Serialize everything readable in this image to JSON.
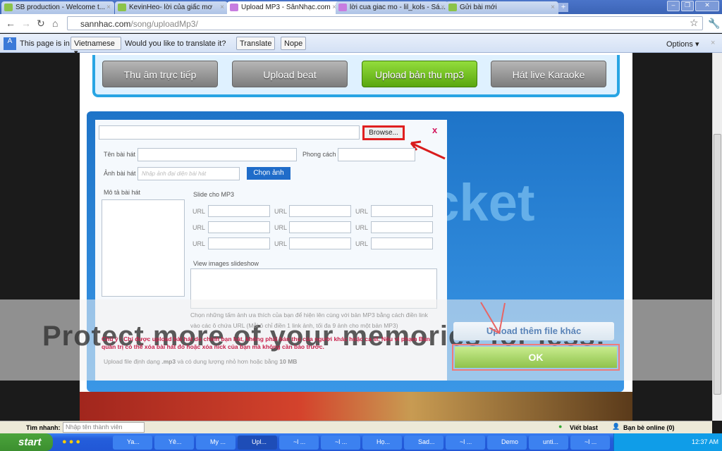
{
  "browser": {
    "tabs": [
      {
        "label": "SB production - Welcome t...",
        "active": false
      },
      {
        "label": "KevinHeo- lời của giấc mơ",
        "active": false
      },
      {
        "label": "Upload MP3 - SânNhạc.com",
        "active": true
      },
      {
        "label": "lời cua giac mo - lil_kols - Sá...",
        "active": false
      },
      {
        "label": "Gửi bài mới",
        "active": false
      }
    ],
    "url_host": "sannhac.com",
    "url_path": "/song/uploadMp3/",
    "translate": {
      "prefix": "This page is in",
      "language": "Vietnamese",
      "question": "Would you like to translate it?",
      "translate_btn": "Translate",
      "nope_btn": "Nope",
      "options": "Options"
    }
  },
  "header_buttons": [
    {
      "label": "Thu âm trực tiếp",
      "active": false
    },
    {
      "label": "Upload beat",
      "active": false
    },
    {
      "label": "Upload bản thu mp3",
      "active": true
    },
    {
      "label": "Hát live Karaoke",
      "active": false
    }
  ],
  "form": {
    "browse": "Browse...",
    "close": "x",
    "song_name_label": "Tên bài hát",
    "style_label": "Phong cách",
    "image_label": "Ảnh bài hát",
    "image_placeholder": "Nhập ảnh đại diện bài hát",
    "choose_image": "Chọn ảnh",
    "desc_label": "Mô tả bài hát",
    "slide_label": "Slide cho MP3",
    "url_label": "URL",
    "slideshow_label": "View images slideshow",
    "slide_note": "Chọn những tấm ảnh ưa thích của bạn để hiện lên cùng với bản MP3 bằng cách điền link vào các ô chứa URL (Mỗi ô chỉ điền 1 link ảnh, tối đa 9 ảnh cho một bản MP3)",
    "warning": "Chú ý : Chỉ được upload bài hát do chính bạn hát, không phải bản thu của người khác hoặc ca sĩ. Nếu vi phạm Ban quản trị có thể xóa bài hát đó hoặc xóa nick của bạn mà không cần báo trước.",
    "limit_prefix": "Upload file định dạng",
    "limit_ext": ".mp3",
    "limit_mid": "và có dung lượng nhỏ hơn hoặc bằng",
    "limit_size": "10 MB"
  },
  "actions": {
    "more": "Upload thêm file khác",
    "ok": "OK"
  },
  "watermark": {
    "photobucket": "bucket",
    "protect": "Protect more of your memories for less!"
  },
  "statusbar": {
    "search_label": "Tìm nhanh:",
    "search_placeholder": "Nhập tên thành viên",
    "blast": "Viết blast",
    "friends": "Bạn bè online (0)"
  },
  "taskbar": {
    "start": "start",
    "items": [
      {
        "label": "Ya..."
      },
      {
        "label": "Yê..."
      },
      {
        "label": "My ..."
      },
      {
        "label": "Upl...",
        "active": true
      },
      {
        "label": "~l ..."
      },
      {
        "label": "~l ..."
      },
      {
        "label": "Họ..."
      },
      {
        "label": "Sad..."
      },
      {
        "label": "~l ..."
      },
      {
        "label": "Demo"
      },
      {
        "label": "unti..."
      },
      {
        "label": "~l ..."
      }
    ],
    "clock": "12:37 AM"
  }
}
